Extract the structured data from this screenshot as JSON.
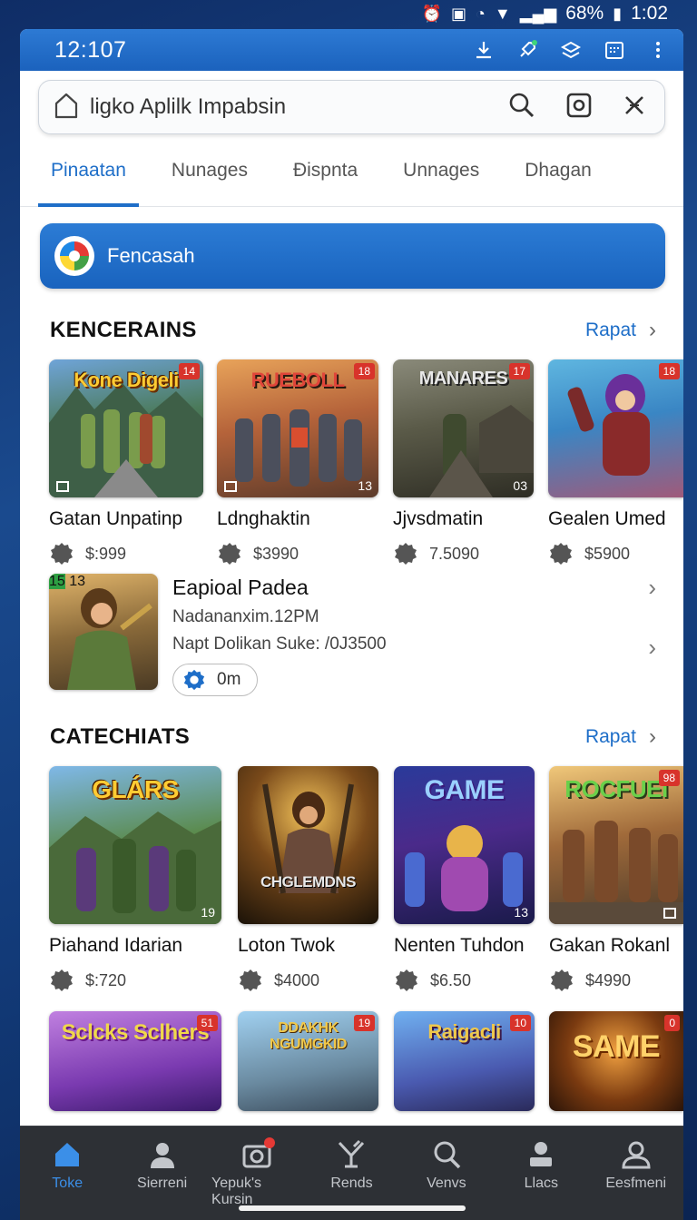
{
  "status": {
    "battery": "68%",
    "time": "1:02"
  },
  "app": {
    "title": "12:107"
  },
  "search": {
    "value": "ligko Aplilk Impabsin"
  },
  "tabs": [
    "Pinaatan",
    "Nunages",
    "Ðispnta",
    "Unnages",
    "Dhagan"
  ],
  "banner": {
    "text": "Fencasah"
  },
  "section1": {
    "title": "KENCERAINS",
    "more": "Rapat",
    "items": [
      {
        "name": "Gatan Unpatinp",
        "price": "$:999",
        "badge": "14",
        "art": "Kone Digeli",
        "age": ""
      },
      {
        "name": "Ldnghaktin",
        "price": "$3990",
        "badge": "18",
        "art": "RUEBOLL",
        "age": "13"
      },
      {
        "name": "Jjvsdmatin",
        "price": "7.5090",
        "badge": "17",
        "art": "MANARES",
        "age": "03"
      },
      {
        "name": "Gealen Umed",
        "price": "$5900",
        "badge": "18",
        "art": "",
        "age": ""
      }
    ]
  },
  "featured": {
    "title": "Eapioal Padea",
    "subtitle1": "Nadananxim.12PM",
    "subtitle2": "Napt Dolikan Suke: /0J3500",
    "pill": "0m",
    "badge": "15",
    "age": "13"
  },
  "section2": {
    "title": "CATECHIATS",
    "more": "Rapat",
    "items": [
      {
        "name": "Piahand Idarian",
        "price": "$:720",
        "art": "GLÁRS",
        "badge": "",
        "age": "19"
      },
      {
        "name": "Loton Twok",
        "price": "$4000",
        "art": "CHGLEMDNS",
        "badge": "",
        "age": ""
      },
      {
        "name": "Nenten Tuhdon",
        "price": "$6.50",
        "art": "GAME",
        "badge": "",
        "age": "13"
      },
      {
        "name": "Gakan Rokanl",
        "price": "$4990",
        "art": "ROCFUEI",
        "badge": "98",
        "age": ""
      }
    ]
  },
  "section3": {
    "items": [
      {
        "art": "Sclcks Sclhers",
        "badge": "51"
      },
      {
        "art": "DDAKHK NGUMGKID",
        "badge": "19"
      },
      {
        "art": "Raigacli",
        "badge": "10"
      },
      {
        "art": "SAME",
        "badge": "0"
      }
    ]
  },
  "nav": [
    "Toke",
    "Sierreni",
    "Yepuk's Kursin",
    "Rends",
    "Venvs",
    "Llacs",
    "Eesfmeni"
  ],
  "colors": {
    "accent": "#1e6ec8",
    "navbar": "#2d3035"
  }
}
